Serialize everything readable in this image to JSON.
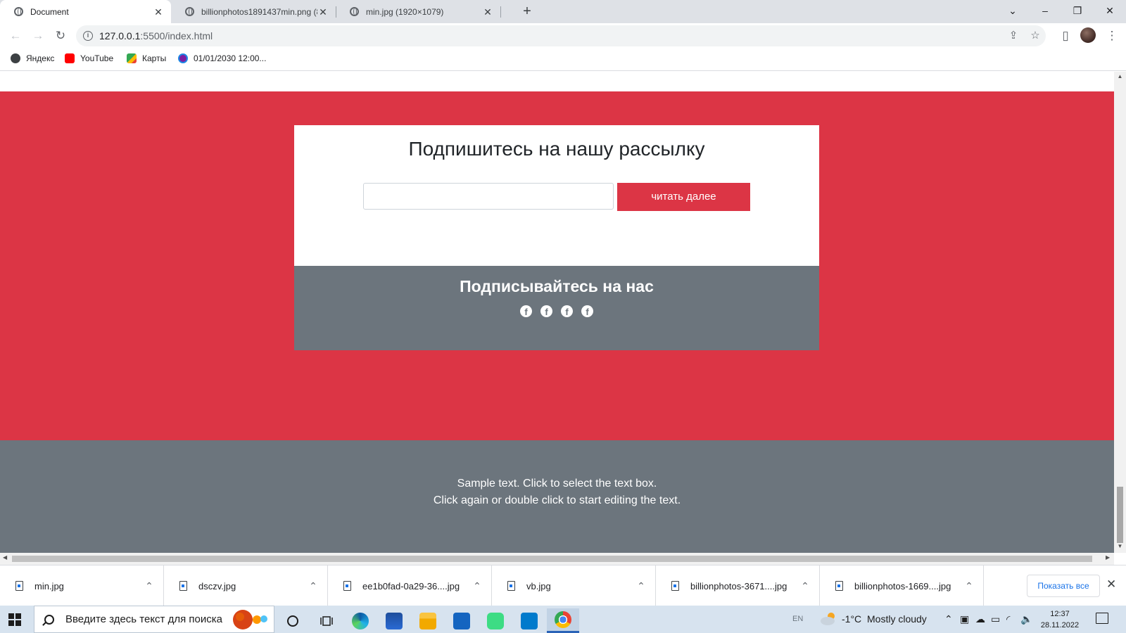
{
  "browser": {
    "tabs": [
      {
        "title": "Document",
        "active": true
      },
      {
        "title": "billionphotos1891437min.png (8…"
      },
      {
        "title": "min.jpg (1920×1079)"
      }
    ],
    "newtab_icon": "plus-icon",
    "window_controls": {
      "dropdown": "⌄",
      "minimize": "–",
      "restore": "❐",
      "close": "✕"
    },
    "toolbar": {
      "url_host": "127.0.0.1",
      "url_path": ":5500/index.html",
      "icons": [
        "back-icon",
        "forward-icon",
        "reload-icon",
        "share-icon",
        "star-icon",
        "side-panel-icon",
        "profile-avatar",
        "menu-icon"
      ]
    },
    "bookmarks": [
      {
        "label": "Яндекс",
        "color": "#3c4043"
      },
      {
        "label": "YouTube",
        "color": "#ff0000"
      },
      {
        "label": "Карты",
        "color": "#34a853"
      },
      {
        "label": "01/01/2030 12:00...",
        "color": "#7b1fa2"
      }
    ]
  },
  "page": {
    "subscribe": {
      "title": "Подпишитесь на нашу рассылку",
      "email_value": "",
      "button_label": "читать далее"
    },
    "follow": {
      "title": "Подписывайтесь на нас",
      "social_icons": [
        "facebook-icon",
        "facebook-icon",
        "facebook-icon",
        "facebook-icon"
      ],
      "social_glyph": "f"
    },
    "footer": {
      "line1": "Sample text. Click to select the text box.",
      "line2": "Click again or double click to start editing the text."
    },
    "colors": {
      "accent_red": "#dc3545",
      "grey": "#6c757d"
    }
  },
  "downloads": {
    "items": [
      "min.jpg",
      "dsczv.jpg",
      "ee1b0fad-0a29-36....jpg",
      "vb.jpg",
      "billionphotos-3671....jpg",
      "billionphotos-1669....jpg"
    ],
    "show_all": "Показать все"
  },
  "taskbar": {
    "search_placeholder": "Введите здесь текст для поиска",
    "lang": "EN",
    "weather_temp": "-1°C",
    "weather_text": "Mostly cloudy",
    "time": "12:37",
    "date": "28.11.2022"
  }
}
